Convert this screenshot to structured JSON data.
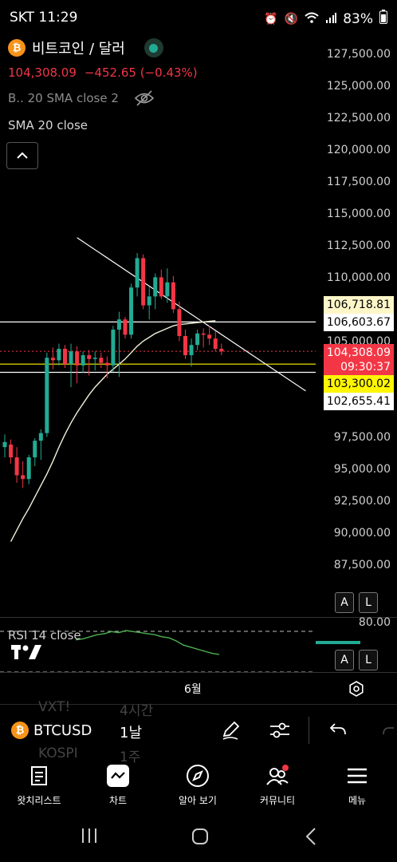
{
  "status": {
    "carrier_time": "SKT 11:29",
    "battery": "83%"
  },
  "header": {
    "symbol_title": "비트코인 / 달러",
    "btc_glyph": "₿",
    "price": "104,308.09",
    "change": "−452.65 (−0.43%)",
    "indicator1": "B.. 20 SMA close 2",
    "indicator2": "SMA 20 close"
  },
  "price_axis": {
    "labels": [
      "127,500.00",
      "125,000.00",
      "122,500.00",
      "120,000.00",
      "117,500.00",
      "115,000.00",
      "112,500.00",
      "110,000.00",
      "105,000.00",
      "97,500.00",
      "95,000.00",
      "92,500.00",
      "90,000.00",
      "87,500.00"
    ],
    "tags": {
      "tag1": "106,718.81",
      "tag2": "106,603.67",
      "current_price": "104,308.09",
      "countdown": "09:30:37",
      "tag_yellow": "103,300.02",
      "tag_white": "102,655.41"
    }
  },
  "scale_buttons": {
    "a": "A",
    "l": "L"
  },
  "rsi": {
    "label": "RSI 14 close",
    "level": "80.00"
  },
  "time_axis": {
    "month": "6월"
  },
  "toolbar": {
    "symbol": "BTCUSD",
    "interval": "1날",
    "ghost1": "VXT!",
    "ghost2": "4시간",
    "ghost3": "KOSPI",
    "ghost4": "1주"
  },
  "nav": {
    "watchlist": "왓치리스트",
    "chart": "차트",
    "explore": "알아 보기",
    "community": "커뮤니티",
    "menu": "메뉴"
  },
  "chart_data": {
    "type": "candlestick",
    "y_axis_range": [
      86000,
      128500
    ],
    "candles": [
      {
        "o": 96800,
        "h": 97800,
        "l": 96000,
        "c": 97200
      },
      {
        "o": 97000,
        "h": 97400,
        "l": 95500,
        "c": 96000
      },
      {
        "o": 96000,
        "h": 96800,
        "l": 94000,
        "c": 94600
      },
      {
        "o": 94600,
        "h": 95700,
        "l": 93600,
        "c": 94300
      },
      {
        "o": 94300,
        "h": 96200,
        "l": 93900,
        "c": 96000
      },
      {
        "o": 96000,
        "h": 97500,
        "l": 95300,
        "c": 97300
      },
      {
        "o": 97300,
        "h": 98200,
        "l": 95800,
        "c": 97900
      },
      {
        "o": 97900,
        "h": 104200,
        "l": 97600,
        "c": 103800
      },
      {
        "o": 103800,
        "h": 104600,
        "l": 102900,
        "c": 103600
      },
      {
        "o": 103600,
        "h": 104900,
        "l": 103200,
        "c": 104500
      },
      {
        "o": 104500,
        "h": 104800,
        "l": 103000,
        "c": 103300
      },
      {
        "o": 103300,
        "h": 104900,
        "l": 101500,
        "c": 104300
      },
      {
        "o": 104300,
        "h": 104700,
        "l": 101800,
        "c": 103200
      },
      {
        "o": 103200,
        "h": 104300,
        "l": 102600,
        "c": 104000
      },
      {
        "o": 104000,
        "h": 104400,
        "l": 102400,
        "c": 103700
      },
      {
        "o": 103700,
        "h": 104300,
        "l": 102800,
        "c": 103800
      },
      {
        "o": 103800,
        "h": 104200,
        "l": 103000,
        "c": 103400
      },
      {
        "o": 103400,
        "h": 103900,
        "l": 102200,
        "c": 103200
      },
      {
        "o": 103200,
        "h": 106300,
        "l": 102700,
        "c": 106000
      },
      {
        "o": 106000,
        "h": 107400,
        "l": 102300,
        "c": 106800
      },
      {
        "o": 106800,
        "h": 107000,
        "l": 105300,
        "c": 105600
      },
      {
        "o": 105600,
        "h": 109600,
        "l": 105300,
        "c": 109300
      },
      {
        "o": 109300,
        "h": 112000,
        "l": 108600,
        "c": 111600
      },
      {
        "o": 111600,
        "h": 111900,
        "l": 107600,
        "c": 107900
      },
      {
        "o": 107900,
        "h": 109400,
        "l": 106800,
        "c": 108600
      },
      {
        "o": 108600,
        "h": 110400,
        "l": 107600,
        "c": 110100
      },
      {
        "o": 110100,
        "h": 110700,
        "l": 108400,
        "c": 108600
      },
      {
        "o": 108600,
        "h": 110800,
        "l": 108100,
        "c": 109700
      },
      {
        "o": 109700,
        "h": 110200,
        "l": 107300,
        "c": 107600
      },
      {
        "o": 107600,
        "h": 108200,
        "l": 105100,
        "c": 105500
      },
      {
        "o": 105500,
        "h": 106000,
        "l": 103700,
        "c": 104000
      },
      {
        "o": 104000,
        "h": 105300,
        "l": 103100,
        "c": 104800
      },
      {
        "o": 104800,
        "h": 106000,
        "l": 104400,
        "c": 105700
      },
      {
        "o": 105700,
        "h": 106100,
        "l": 104600,
        "c": 105600
      },
      {
        "o": 105600,
        "h": 106300,
        "l": 104800,
        "c": 105300
      },
      {
        "o": 105300,
        "h": 105900,
        "l": 104300,
        "c": 104500
      },
      {
        "o": 104500,
        "h": 104900,
        "l": 104000,
        "c": 104300
      }
    ],
    "sma20": [
      89400,
      90300,
      91200,
      92000,
      92900,
      93800,
      94700,
      95700,
      96800,
      97800,
      98700,
      99500,
      100200,
      100900,
      101500,
      102000,
      102500,
      102900,
      103300,
      103700,
      104200,
      104700,
      105100,
      105400,
      105700,
      105900,
      106100,
      106300,
      106400,
      106450,
      106500,
      106550,
      106600,
      106650,
      106700
    ],
    "horizontal_lines": [
      106603.67,
      103300.02,
      102655.41
    ],
    "trendline": {
      "from": [
        12,
        113200
      ],
      "to": [
        50,
        101200
      ]
    },
    "rsi_series": [
      71,
      72,
      74,
      76,
      77,
      79,
      78,
      80,
      79,
      78,
      77,
      76,
      74,
      73,
      70,
      66,
      64,
      62,
      60,
      58,
      57
    ]
  }
}
